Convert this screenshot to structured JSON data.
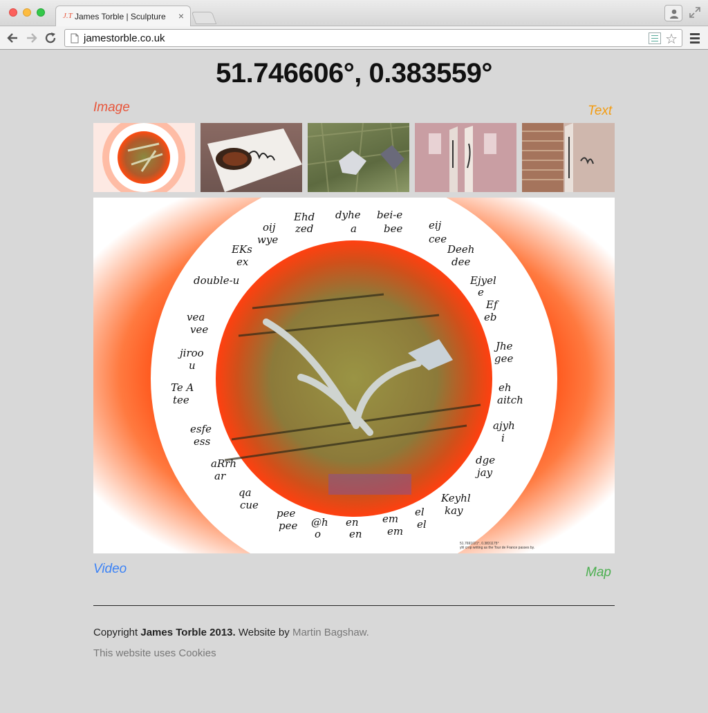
{
  "browser": {
    "tab_favicon": "J.T",
    "tab_title": "James Torble | Sculpture",
    "tab_close": "×",
    "url": "jamestorble.co.uk",
    "icons": [
      "page-icon",
      "reader-mode-icon",
      "star-icon",
      "menu-icon",
      "back-icon",
      "forward-icon",
      "reload-icon",
      "profile-icon",
      "fullscreen-icon"
    ]
  },
  "page": {
    "title": "51.746606°, 0.383559°",
    "labels": {
      "image": "Image",
      "text": "Text",
      "video": "Video",
      "map": "Map"
    },
    "label_colors": {
      "image": "#e8553a",
      "text": "#f39c12",
      "video": "#3b82f6",
      "map": "#4caf50"
    },
    "main_image": {
      "caption_line1": "51.7691021°, 0.3831175°",
      "caption_line2": "yhl crop writing as the Tour de France passes by.",
      "ring_words": [
        "Ehd",
        "zed",
        "dyhe",
        "a",
        "bei-e",
        "bee",
        "eij",
        "cee",
        "Deeh",
        "dee",
        "Ejyel",
        "e",
        "Ef",
        "eb",
        "Jhe",
        "gee",
        "eh",
        "aitch",
        "ajyh",
        "i",
        "dge",
        "jay",
        "Keyhl",
        "kay",
        "el",
        "em",
        "en",
        "o",
        "pee",
        "cue",
        "ar",
        "ess",
        "tee",
        "u",
        "vee",
        "double-u",
        "ex",
        "wye"
      ]
    }
  },
  "footer": {
    "copyright_prefix": "Copyright ",
    "copyright_owner": "James Torble 2013.",
    "website_by": " Website by ",
    "author": "Martin Bagshaw.",
    "cookies": "This website uses Cookies"
  }
}
